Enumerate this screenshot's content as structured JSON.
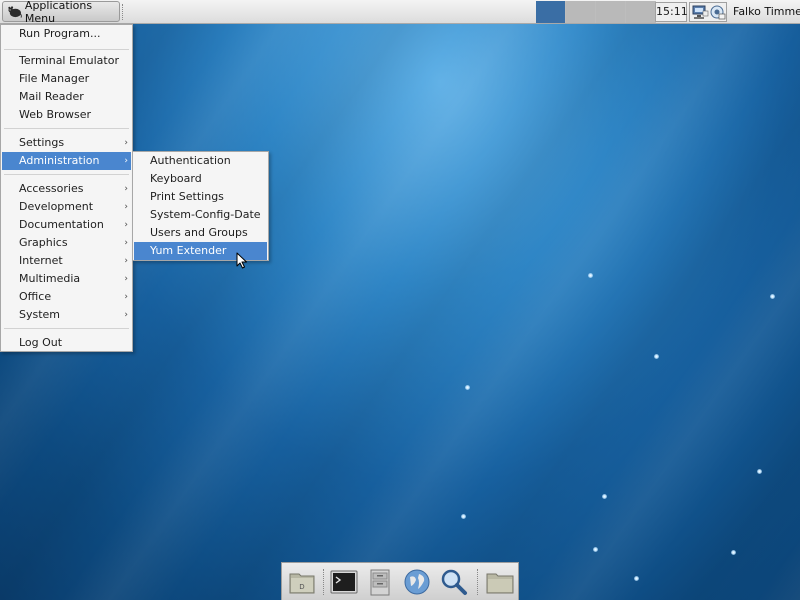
{
  "top_panel": {
    "apps_button_label": "Applications Menu",
    "clock": "15:11",
    "username": "Falko Timme",
    "workspaces": [
      {
        "name": "workspace-1",
        "active": true
      },
      {
        "name": "workspace-2",
        "active": false
      },
      {
        "name": "workspace-3",
        "active": false
      },
      {
        "name": "workspace-4",
        "active": false
      }
    ],
    "tray_icons": [
      "network-icon",
      "update-notifier-icon"
    ]
  },
  "apps_menu": {
    "items": [
      {
        "label": "Run Program...",
        "submenu": false,
        "highlighted": false
      },
      {
        "label": "Terminal Emulator",
        "submenu": false,
        "highlighted": false
      },
      {
        "label": "File Manager",
        "submenu": false,
        "highlighted": false
      },
      {
        "label": "Mail Reader",
        "submenu": false,
        "highlighted": false
      },
      {
        "label": "Web Browser",
        "submenu": false,
        "highlighted": false
      },
      {
        "label": "Settings",
        "submenu": true,
        "highlighted": false
      },
      {
        "label": "Administration",
        "submenu": true,
        "highlighted": true
      },
      {
        "label": "Accessories",
        "submenu": true,
        "highlighted": false
      },
      {
        "label": "Development",
        "submenu": true,
        "highlighted": false
      },
      {
        "label": "Documentation",
        "submenu": true,
        "highlighted": false
      },
      {
        "label": "Graphics",
        "submenu": true,
        "highlighted": false
      },
      {
        "label": "Internet",
        "submenu": true,
        "highlighted": false
      },
      {
        "label": "Multimedia",
        "submenu": true,
        "highlighted": false
      },
      {
        "label": "Office",
        "submenu": true,
        "highlighted": false
      },
      {
        "label": "System",
        "submenu": true,
        "highlighted": false
      },
      {
        "label": "Log Out",
        "submenu": false,
        "highlighted": false
      }
    ],
    "submenu_arrow": "›"
  },
  "admin_submenu": {
    "items": [
      {
        "label": "Authentication",
        "highlighted": false
      },
      {
        "label": "Keyboard",
        "highlighted": false
      },
      {
        "label": "Print Settings",
        "highlighted": false
      },
      {
        "label": "System-Config-Date",
        "highlighted": false
      },
      {
        "label": "Users and Groups",
        "highlighted": false
      },
      {
        "label": "Yum Extender",
        "highlighted": true
      }
    ]
  },
  "dock": {
    "items": [
      "show-desktop-icon",
      "terminal-icon",
      "file-manager-icon",
      "web-browser-icon",
      "search-icon",
      "folder-icon"
    ]
  },
  "colors": {
    "highlight": "#4a86cf",
    "active_workspace": "#3a6ea5",
    "menu_bg": "#f5f5f5"
  }
}
